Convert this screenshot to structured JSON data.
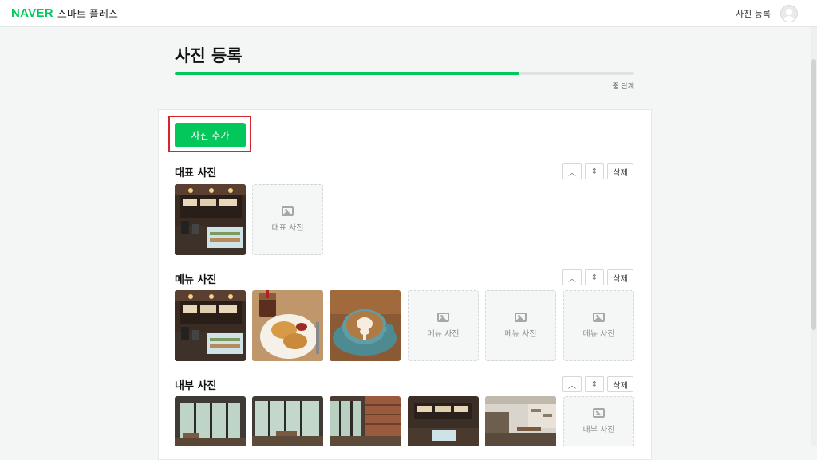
{
  "header": {
    "brand_logo": "NAVER",
    "brand_name": "스마트 플레스",
    "page_label": "사진 등록",
    "avatar_icon": "user-avatar-icon"
  },
  "page": {
    "title": "사진 등록",
    "progress_text": "중 단계",
    "progress_fraction": 0.75
  },
  "toolbar": {
    "add_label": "사진 추가"
  },
  "sections": [
    {
      "title": "대표 사진",
      "delete_label": "삭제",
      "photos": [
        "cafe-counter-photo"
      ],
      "placeholders": [
        "대표 사진"
      ]
    },
    {
      "title": "메뉴 사진",
      "delete_label": "삭제",
      "photos": [
        "cafe-counter-photo",
        "pastry-iced-coffee-photo",
        "latte-art-photo"
      ],
      "placeholders": [
        "메뉴 사진",
        "메뉴 사진",
        "메뉴 사진"
      ]
    },
    {
      "title": "내부 사진",
      "delete_label": "삭제",
      "photos": [
        "interior-window-photo",
        "interior-window-photo",
        "interior-brick-photo",
        "interior-counter-photo",
        "interior-seating-photo"
      ],
      "placeholders": [
        "내부 사진"
      ]
    }
  ],
  "colors": {
    "accent": "#03c75a",
    "highlight": "#d6262b"
  }
}
